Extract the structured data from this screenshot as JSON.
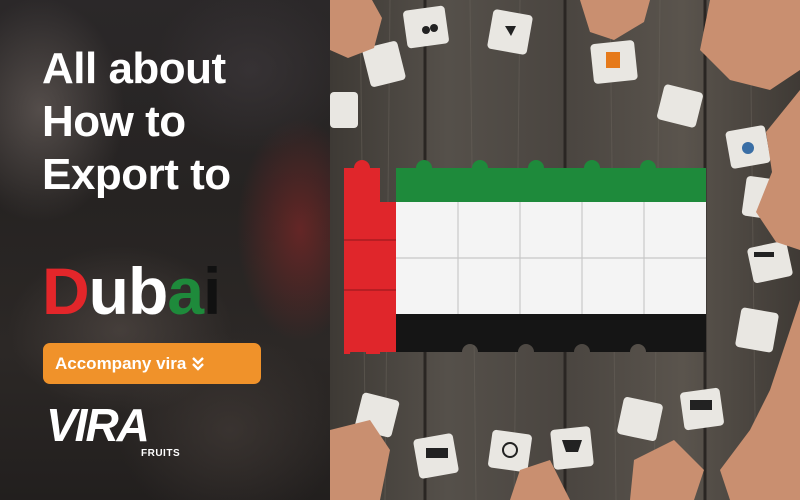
{
  "headline": {
    "lines": [
      "All about",
      "How to",
      "Export to"
    ],
    "dubai": {
      "letters": [
        {
          "char": "D",
          "color": "#e3262a"
        },
        {
          "char": "u",
          "color": "#ffffff"
        },
        {
          "char": "b",
          "color": "#ffffff"
        },
        {
          "char": "a",
          "color": "#1e8a3b"
        },
        {
          "char": "i",
          "color": "#111111"
        }
      ]
    }
  },
  "cta": {
    "label": "Accompany vira",
    "icon": "double-chevron-down-icon",
    "color": "#f0922a"
  },
  "logo": {
    "word": "VIRA",
    "sub": "FRUITS"
  },
  "flag": {
    "red": "#e0262b",
    "green": "#1e8a3b",
    "white": "#f4f4f4",
    "black": "#151515"
  }
}
